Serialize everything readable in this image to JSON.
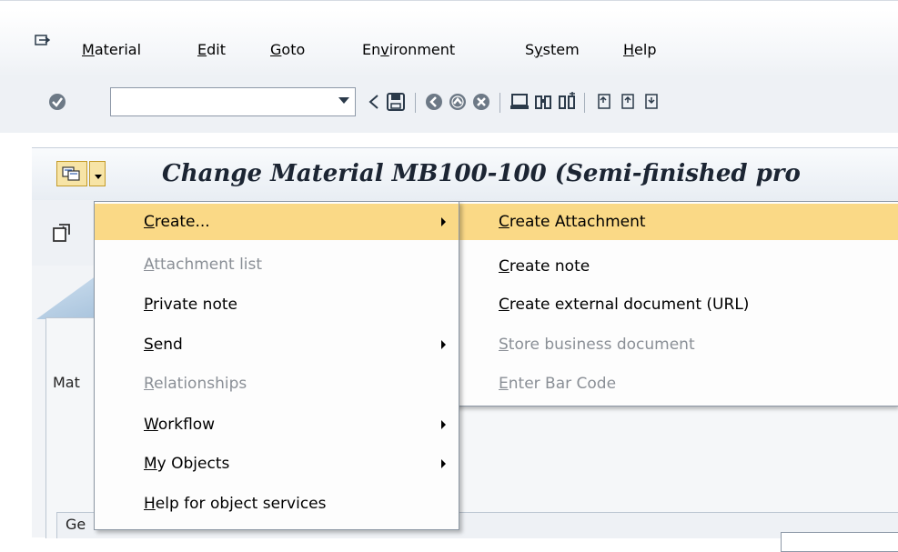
{
  "menubar": {
    "items": [
      {
        "label": "Material",
        "mnemonic": "M",
        "rest": "aterial"
      },
      {
        "label": "Edit",
        "mnemonic": "E",
        "rest": "dit"
      },
      {
        "label": "Goto",
        "mnemonic": "G",
        "rest": "oto"
      },
      {
        "label": "Environment",
        "pre": "En",
        "mnemonic": "v",
        "rest": "ironment"
      },
      {
        "label": "System",
        "pre": "S",
        "mnemonic": "y",
        "rest": "stem"
      },
      {
        "label": "Help",
        "mnemonic": "H",
        "rest": "elp"
      }
    ]
  },
  "toolbar": {
    "command_value": "",
    "icons": [
      "enter-icon",
      "back-arrow-icon",
      "save-icon",
      "back-icon",
      "exit-icon",
      "cancel-icon",
      "print-icon",
      "find-icon",
      "find-next-icon",
      "first-page-icon",
      "previous-page-icon",
      "next-page-icon"
    ]
  },
  "title": {
    "text": "Change Material MB100-100 (Semi-finished pro"
  },
  "background": {
    "mat_label": "Mat",
    "ge_label": "Ge"
  },
  "menu_primary": {
    "items": [
      {
        "mnemonic": "C",
        "rest": "reate...",
        "disabled": false,
        "submenu": true,
        "highlighted": true
      },
      {
        "mnemonic": "A",
        "rest": "ttachment list",
        "disabled": true,
        "submenu": false
      },
      {
        "mnemonic": "P",
        "rest": "rivate note",
        "disabled": false,
        "submenu": false
      },
      {
        "mnemonic": "S",
        "rest": "end",
        "disabled": false,
        "submenu": true
      },
      {
        "mnemonic": "R",
        "rest": "elationships",
        "disabled": true,
        "submenu": false
      },
      {
        "mnemonic": "W",
        "rest": "orkflow",
        "disabled": false,
        "submenu": true
      },
      {
        "mnemonic": "M",
        "rest": "y Objects",
        "disabled": false,
        "submenu": true
      },
      {
        "mnemonic": "H",
        "rest": "elp for object services",
        "disabled": false,
        "submenu": false
      }
    ]
  },
  "menu_create": {
    "items": [
      {
        "mnemonic": "C",
        "rest": "reate Attachment",
        "disabled": false,
        "highlighted": true
      },
      {
        "mnemonic": "C",
        "rest": "reate note",
        "disabled": false
      },
      {
        "mnemonic": "C",
        "rest": "reate external document (URL)",
        "disabled": false
      },
      {
        "mnemonic": "S",
        "rest": "tore business document",
        "disabled": true
      },
      {
        "mnemonic": "E",
        "rest": "nter Bar Code",
        "disabled": true
      }
    ]
  },
  "colors": {
    "highlight": "#fad986",
    "disabled_text": "#8a8f96",
    "menu_border": "#8b96a3"
  }
}
